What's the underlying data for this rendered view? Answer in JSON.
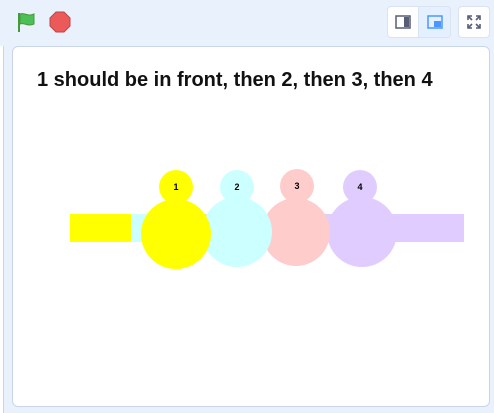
{
  "toolbar": {
    "green_flag_icon": "green-flag-icon",
    "stop_icon": "stop-icon",
    "small_stage_icon": "small-stage-icon",
    "normal_stage_icon": "normal-stage-icon",
    "fullscreen_icon": "fullscreen-icon"
  },
  "stage": {
    "text": "1 should be in front, then 2, then 3, then 4"
  },
  "sprites": [
    {
      "label": "1",
      "color": "#ffff00"
    },
    {
      "label": "2",
      "color": "#ccffff"
    },
    {
      "label": "3",
      "color": "#ffcccc"
    },
    {
      "label": "4",
      "color": "#e0ccff"
    }
  ],
  "colors": {
    "flag_green": "#4cbf56",
    "stop_red": "#ec5959",
    "accent_blue": "#4c97ff"
  }
}
